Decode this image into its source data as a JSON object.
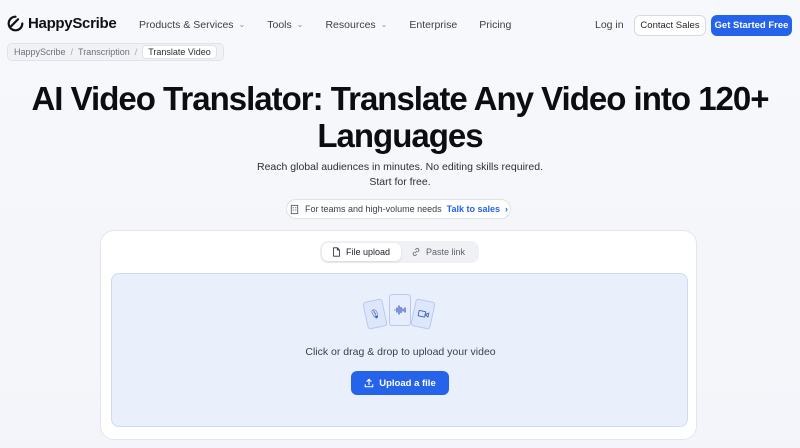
{
  "brand": {
    "name": "HappyScribe",
    "color": "#2563eb"
  },
  "nav": {
    "items": [
      {
        "label": "Products & Services",
        "dropdown": true
      },
      {
        "label": "Tools",
        "dropdown": true
      },
      {
        "label": "Resources",
        "dropdown": true
      },
      {
        "label": "Enterprise",
        "dropdown": false
      },
      {
        "label": "Pricing",
        "dropdown": false
      }
    ],
    "login": "Log in",
    "contact": "Contact Sales",
    "cta": "Get Started Free"
  },
  "breadcrumb": {
    "items": [
      "HappyScribe",
      "Transcription"
    ],
    "current": "Translate Video"
  },
  "hero": {
    "title": "AI Video Translator: Translate Any Video into 120+ Languages",
    "subtitle": "Reach global audiences in minutes. No editing skills required. Start for free.",
    "pill_text": "For teams and high-volume needs",
    "pill_link": "Talk to sales"
  },
  "upload": {
    "tabs": [
      {
        "label": "File upload",
        "icon": "file-icon",
        "active": true
      },
      {
        "label": "Paste link",
        "icon": "link-icon",
        "active": false
      }
    ],
    "file_icons": [
      "mic-icon",
      "audio-wave-icon",
      "video-icon"
    ],
    "drop_text": "Click or drag & drop to upload your video",
    "button": "Upload a file"
  }
}
